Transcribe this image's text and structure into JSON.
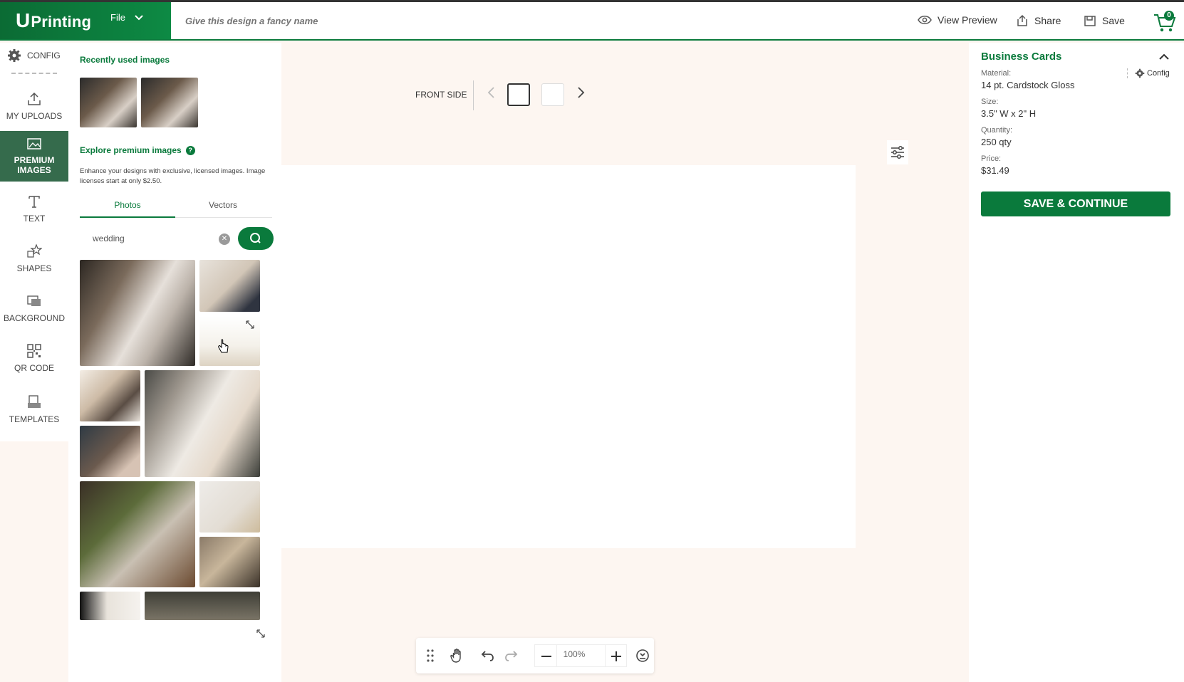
{
  "brand": {
    "logo": "Printing",
    "logo_initial": "U"
  },
  "header": {
    "file_label": "File",
    "design_name_placeholder": "Give this design a fancy name",
    "view_preview": "View Preview",
    "share": "Share",
    "save": "Save",
    "cart_count": "0"
  },
  "left_nav": {
    "config": "CONFIG",
    "my_uploads": "MY UPLOADS",
    "premium_images_1": "PREMIUM",
    "premium_images_2": "IMAGES",
    "text": "TEXT",
    "shapes": "SHAPES",
    "background": "BACKGROUND",
    "qr_code": "QR CODE",
    "templates": "TEMPLATES"
  },
  "images_panel": {
    "recent_heading": "Recently used images",
    "premium_heading": "Explore premium images",
    "description": "Enhance your designs with exclusive, licensed images. Image licenses start at only $2.50.",
    "tabs": [
      "Photos",
      "Vectors"
    ],
    "search_value": "wedding"
  },
  "canvas": {
    "side_label": "FRONT SIDE",
    "zoom": "100%"
  },
  "order": {
    "title": "Business Cards",
    "config_label": "Config",
    "material_label": "Material:",
    "material": "14 pt. Cardstock Gloss",
    "size_label": "Size:",
    "size": "3.5\" W x 2\" H",
    "quantity_label": "Quantity:",
    "quantity": "250 qty",
    "price_label": "Price:",
    "price": "$31.49",
    "cta": "SAVE & CONTINUE"
  },
  "colors": {
    "brand_green": "#0a7a3c",
    "nav_active": "#356b4c"
  }
}
